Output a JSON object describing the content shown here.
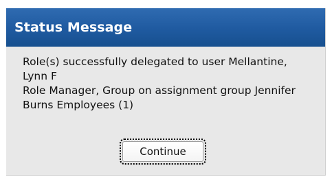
{
  "dialog": {
    "title": "Status Message",
    "message_lines": [
      "Role(s) successfully delegated to user Mellantine,",
      "Lynn F",
      "Role Manager, Group on assignment group Jennifer",
      "Burns Employees (1)"
    ],
    "continue_label": "Continue"
  },
  "colors": {
    "titlebar": "#1f5aa0",
    "dialog_background": "#e8e8e8"
  }
}
